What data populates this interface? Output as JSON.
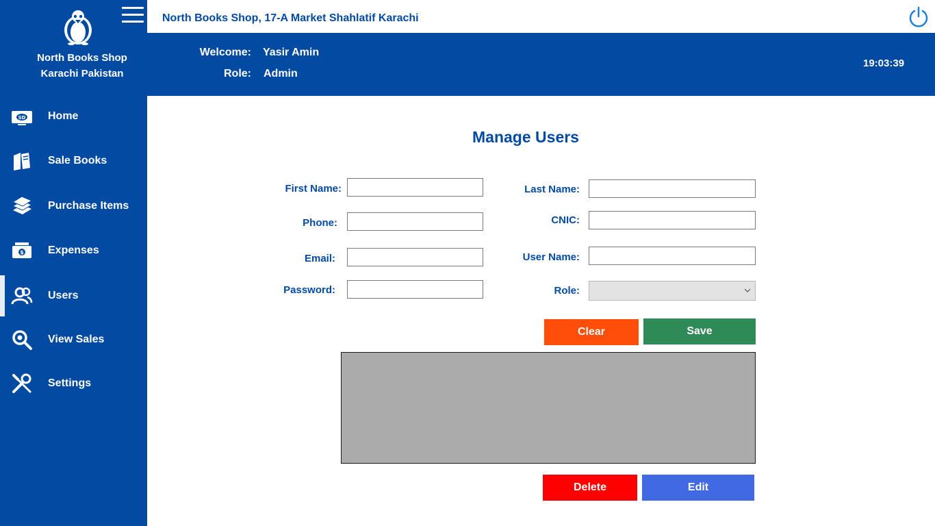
{
  "brand": {
    "line1": "North Books Shop",
    "line2": "Karachi Pakistan",
    "logo_icon": "penguin-logo-icon",
    "menu_icon": "hamburger-menu-icon"
  },
  "header": {
    "shop_title": "North Books Shop, 17-A Market Shahlatif Karachi",
    "welcome_label": "Welcome:",
    "welcome_value": "Yasir Amin",
    "role_label": "Role:",
    "role_value": "Admin",
    "clock": "19:03:39",
    "power_icon": "power-icon"
  },
  "sidebar": {
    "items": [
      {
        "label": "Home",
        "icon": "home-monitor-icon"
      },
      {
        "label": "Sale Books",
        "icon": "books-icon"
      },
      {
        "label": "Purchase Items",
        "icon": "book-stack-icon"
      },
      {
        "label": "Expenses",
        "icon": "money-icon"
      },
      {
        "label": "Users",
        "icon": "users-icon",
        "active": true
      },
      {
        "label": "View Sales",
        "icon": "search-icon"
      },
      {
        "label": "Settings",
        "icon": "tools-icon"
      }
    ]
  },
  "form": {
    "title": "Manage Users",
    "first_name_label": "First Name:",
    "last_name_label": "Last Name:",
    "phone_label": "Phone:",
    "cnic_label": "CNIC:",
    "email_label": "Email:",
    "user_name_label": "User Name:",
    "password_label": "Password:",
    "role_label": "Role:",
    "first_name_value": "",
    "last_name_value": "",
    "phone_value": "",
    "cnic_value": "",
    "email_value": "",
    "user_name_value": "",
    "password_value": "",
    "role_value": ""
  },
  "buttons": {
    "clear": "Clear",
    "save": "Save",
    "delete": "Delete",
    "edit": "Edit"
  },
  "colors": {
    "primary": "#034AA3",
    "clear": "#FF4E0A",
    "save": "#2E8B57",
    "delete": "#FF0000",
    "edit": "#4169E1",
    "grid_bg": "#ABABAB"
  }
}
